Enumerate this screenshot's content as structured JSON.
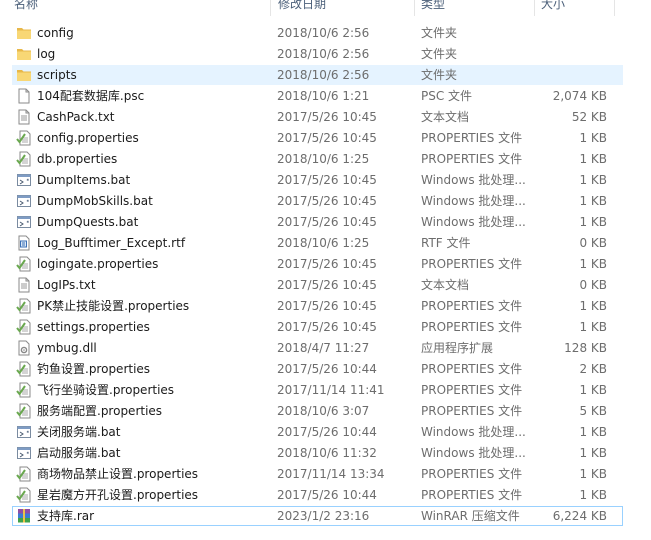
{
  "columns": {
    "name": "名称",
    "date": "修改日期",
    "type": "类型",
    "size": "大小"
  },
  "files": [
    {
      "name": "config",
      "date": "2018/10/6 2:56",
      "type": "文件夹",
      "size": "",
      "icon": "folder-icon"
    },
    {
      "name": "log",
      "date": "2018/10/6 2:56",
      "type": "文件夹",
      "size": "",
      "icon": "folder-icon"
    },
    {
      "name": "scripts",
      "date": "2018/10/6 2:56",
      "type": "文件夹",
      "size": "",
      "icon": "folder-icon"
    },
    {
      "name": "104配套数据库.psc",
      "date": "2018/10/6 1:21",
      "type": "PSC 文件",
      "size": "2,074 KB",
      "icon": "blank-file-icon"
    },
    {
      "name": "CashPack.txt",
      "date": "2017/5/26 10:45",
      "type": "文本文档",
      "size": "52 KB",
      "icon": "text-file-icon"
    },
    {
      "name": "config.properties",
      "date": "2017/5/26 10:45",
      "type": "PROPERTIES 文件",
      "size": "1 KB",
      "icon": "properties-file-icon"
    },
    {
      "name": "db.properties",
      "date": "2018/10/6 1:25",
      "type": "PROPERTIES 文件",
      "size": "1 KB",
      "icon": "properties-file-icon"
    },
    {
      "name": "DumpItems.bat",
      "date": "2017/5/26 10:45",
      "type": "Windows 批处理...",
      "size": "1 KB",
      "icon": "batch-file-icon"
    },
    {
      "name": "DumpMobSkills.bat",
      "date": "2017/5/26 10:45",
      "type": "Windows 批处理...",
      "size": "1 KB",
      "icon": "batch-file-icon"
    },
    {
      "name": "DumpQuests.bat",
      "date": "2017/5/26 10:45",
      "type": "Windows 批处理...",
      "size": "1 KB",
      "icon": "batch-file-icon"
    },
    {
      "name": "Log_Bufftimer_Except.rtf",
      "date": "2018/10/6 1:25",
      "type": "RTF 文件",
      "size": "0 KB",
      "icon": "rtf-file-icon"
    },
    {
      "name": "logingate.properties",
      "date": "2017/5/26 10:45",
      "type": "PROPERTIES 文件",
      "size": "1 KB",
      "icon": "properties-file-icon"
    },
    {
      "name": "LogIPs.txt",
      "date": "2017/5/26 10:45",
      "type": "文本文档",
      "size": "0 KB",
      "icon": "text-file-icon"
    },
    {
      "name": "PK禁止技能设置.properties",
      "date": "2017/5/26 10:45",
      "type": "PROPERTIES 文件",
      "size": "1 KB",
      "icon": "properties-file-icon"
    },
    {
      "name": "settings.properties",
      "date": "2017/5/26 10:45",
      "type": "PROPERTIES 文件",
      "size": "1 KB",
      "icon": "properties-file-icon"
    },
    {
      "name": "ymbug.dll",
      "date": "2018/4/7 11:27",
      "type": "应用程序扩展",
      "size": "128 KB",
      "icon": "dll-file-icon"
    },
    {
      "name": "钓鱼设置.properties",
      "date": "2017/5/26 10:44",
      "type": "PROPERTIES 文件",
      "size": "2 KB",
      "icon": "properties-file-icon"
    },
    {
      "name": "飞行坐骑设置.properties",
      "date": "2017/11/14 11:41",
      "type": "PROPERTIES 文件",
      "size": "1 KB",
      "icon": "properties-file-icon"
    },
    {
      "name": "服务端配置.properties",
      "date": "2018/10/6 3:07",
      "type": "PROPERTIES 文件",
      "size": "5 KB",
      "icon": "properties-file-icon"
    },
    {
      "name": "关闭服务端.bat",
      "date": "2017/5/26 10:44",
      "type": "Windows 批处理...",
      "size": "1 KB",
      "icon": "batch-file-icon"
    },
    {
      "name": "启动服务端.bat",
      "date": "2018/10/6 11:32",
      "type": "Windows 批处理...",
      "size": "1 KB",
      "icon": "batch-file-icon"
    },
    {
      "name": "商场物品禁止设置.properties",
      "date": "2017/11/14 13:34",
      "type": "PROPERTIES 文件",
      "size": "1 KB",
      "icon": "properties-file-icon"
    },
    {
      "name": "星岩魔方开孔设置.properties",
      "date": "2017/5/26 10:44",
      "type": "PROPERTIES 文件",
      "size": "1 KB",
      "icon": "properties-file-icon"
    },
    {
      "name": "支持库.rar",
      "date": "2023/1/2 23:16",
      "type": "WinRAR 压缩文件",
      "size": "6,224 KB",
      "icon": "rar-archive-icon"
    }
  ],
  "state": {
    "hovered_index": 2,
    "focused_index": 23
  },
  "colors": {
    "hover_bg": "#e5f3ff",
    "focus_border": "#99d1ff",
    "folder": "#f8d775",
    "properties_check": "#6aa84f"
  }
}
